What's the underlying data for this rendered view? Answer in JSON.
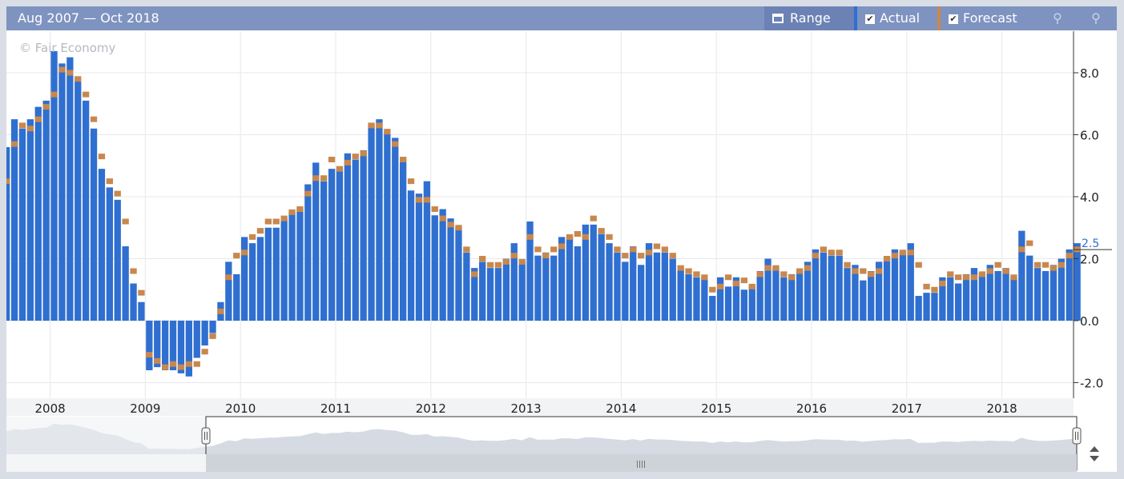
{
  "toolbar": {
    "range_title": "Aug 2007 — Oct 2018",
    "range_label": "Range",
    "actual_label": "Actual",
    "forecast_label": "Forecast",
    "range_icon": "calendar-icon",
    "zoom_in_icon": "zoom-in-icon",
    "zoom_out_icon": "zoom-out-icon",
    "check_icon": "checkbox-checked-icon"
  },
  "copyright": "© Fair Economy",
  "colors": {
    "actual": "#2f6fd0",
    "forecast": "#c8884d",
    "toolbar": "#7e93c0",
    "navigator_fill": "#d6dbe3"
  },
  "chart_data": {
    "type": "bar",
    "x_start": "2007-08",
    "x_end": "2018-10",
    "frequency": "monthly",
    "ylim": [
      -2.2,
      9.0
    ],
    "y_ticks": [
      "8.0",
      "6.0",
      "4.0",
      "2.0",
      "0.0",
      "-2.0"
    ],
    "y_tick_values": [
      8,
      6,
      4,
      2,
      0,
      -2
    ],
    "x_tick_labels": [
      "2008",
      "2009",
      "2010",
      "2011",
      "2012",
      "2013",
      "2014",
      "2015",
      "2016",
      "2017",
      "2018"
    ],
    "last_value_label": "2.5",
    "grid": true,
    "series": [
      {
        "name": "Actual",
        "values": [
          5.6,
          6.5,
          6.2,
          6.5,
          6.9,
          7.1,
          8.7,
          8.3,
          8.5,
          7.8,
          7.1,
          6.2,
          4.9,
          4.3,
          3.9,
          2.4,
          1.2,
          0.6,
          -1.6,
          -1.5,
          -1.6,
          -1.6,
          -1.7,
          -1.8,
          -1.2,
          -0.8,
          -0.4,
          0.6,
          1.9,
          1.5,
          2.7,
          2.5,
          2.7,
          3.0,
          3.0,
          3.3,
          3.5,
          3.6,
          4.4,
          5.1,
          4.5,
          4.9,
          4.9,
          5.4,
          5.2,
          5.5,
          6.3,
          6.5,
          6.1,
          5.9,
          5.2,
          4.2,
          4.1,
          4.5,
          3.4,
          3.6,
          3.3,
          3.0,
          2.2,
          1.7,
          1.9,
          1.7,
          1.7,
          2.0,
          2.5,
          1.9,
          3.2,
          2.1,
          2.2,
          2.1,
          2.7,
          2.7,
          2.4,
          3.1,
          3.1,
          2.8,
          2.5,
          2.2,
          1.9,
          2.4,
          1.8,
          2.5,
          2.2,
          2.2,
          2.0,
          1.7,
          1.5,
          1.4,
          1.4,
          0.8,
          1.4,
          1.1,
          1.4,
          1.0,
          1.1,
          1.6,
          2.0,
          1.7,
          1.4,
          1.5,
          1.6,
          1.9,
          2.3,
          2.2,
          2.1,
          2.1,
          1.7,
          1.8,
          1.3,
          1.6,
          1.9,
          2.0,
          2.3,
          2.2,
          2.5,
          0.8,
          0.9,
          0.9,
          1.4,
          1.4,
          1.2,
          1.5,
          1.7,
          1.5,
          1.8,
          1.6,
          1.7,
          1.4,
          2.9,
          2.1,
          1.7,
          1.6,
          1.8,
          2.0,
          2.3,
          2.5
        ]
      },
      {
        "name": "Forecast",
        "values": [
          4.5,
          5.7,
          6.3,
          6.2,
          6.5,
          6.9,
          7.3,
          8.1,
          8.0,
          7.8,
          7.3,
          6.5,
          5.3,
          4.5,
          4.1,
          3.2,
          1.6,
          0.9,
          -1.1,
          -1.3,
          -1.5,
          -1.4,
          -1.5,
          -1.4,
          -1.4,
          -1.0,
          -0.5,
          0.3,
          1.4,
          2.1,
          2.2,
          2.7,
          2.9,
          3.2,
          3.2,
          3.3,
          3.5,
          3.6,
          4.1,
          4.6,
          4.6,
          5.2,
          4.9,
          5.1,
          5.3,
          5.4,
          6.3,
          6.3,
          6.1,
          5.7,
          5.2,
          4.5,
          3.9,
          3.9,
          3.6,
          3.3,
          3.1,
          3.0,
          2.3,
          1.5,
          2.0,
          1.8,
          1.8,
          1.9,
          2.1,
          1.9,
          2.7,
          2.3,
          2.1,
          2.3,
          2.4,
          2.7,
          2.8,
          2.7,
          3.3,
          2.9,
          2.7,
          2.3,
          2.1,
          2.3,
          2.1,
          2.2,
          2.4,
          2.3,
          2.1,
          1.7,
          1.6,
          1.5,
          1.4,
          1.0,
          1.1,
          1.4,
          1.2,
          1.3,
          1.1,
          1.5,
          1.7,
          1.7,
          1.5,
          1.4,
          1.6,
          1.7,
          2.1,
          2.3,
          2.2,
          2.2,
          1.8,
          1.6,
          1.6,
          1.5,
          1.6,
          2.0,
          2.1,
          2.2,
          2.2,
          1.8,
          1.1,
          1.0,
          1.2,
          1.5,
          1.4,
          1.4,
          1.4,
          1.5,
          1.6,
          1.8,
          1.6,
          1.4,
          2.3,
          2.5,
          1.8,
          1.8,
          1.7,
          1.8,
          2.1,
          2.3
        ]
      }
    ],
    "navigator_series": "Actual"
  }
}
